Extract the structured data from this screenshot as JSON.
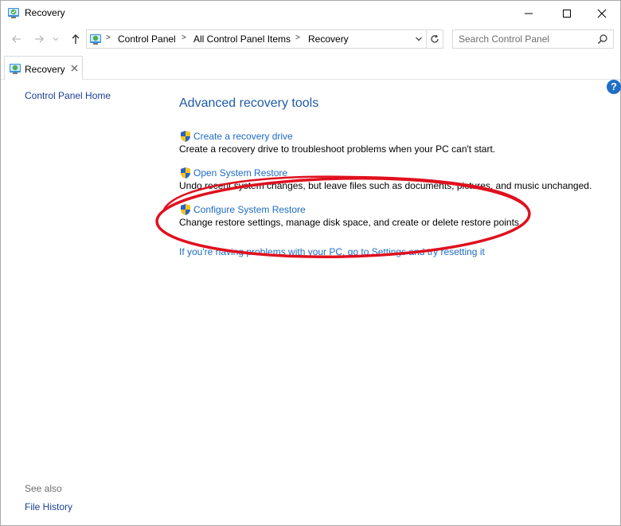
{
  "window": {
    "title": "Recovery",
    "minimize_label": "Minimize",
    "maximize_label": "Maximize",
    "close_label": "Close"
  },
  "address": {
    "crumbs": [
      "Control Panel",
      "All Control Panel Items",
      "Recovery"
    ],
    "separator": ">"
  },
  "search": {
    "placeholder": "Search Control Panel"
  },
  "tab": {
    "label": "Recovery"
  },
  "help": {
    "glyph": "?"
  },
  "sidebar": {
    "home_link": "Control Panel Home",
    "see_also_label": "See also",
    "see_also_items": [
      "File History"
    ]
  },
  "main": {
    "heading": "Advanced recovery tools",
    "items": [
      {
        "link": "Create a recovery drive",
        "description": "Create a recovery drive to troubleshoot problems when your PC can't start."
      },
      {
        "link": "Open System Restore",
        "description": "Undo recent system changes, but leave files such as documents, pictures, and music unchanged."
      },
      {
        "link": "Configure System Restore",
        "description": "Change restore settings, manage disk space, and create or delete restore points."
      }
    ],
    "reset_link": "If you're having problems with your PC, go to Settings and try resetting it"
  },
  "colors": {
    "link": "#1e6bc5",
    "heading": "#1e5aa8",
    "annotation": "#e0101e"
  },
  "icons": {
    "app": "control-panel-recovery-icon",
    "item": "uac-shield-icon"
  }
}
